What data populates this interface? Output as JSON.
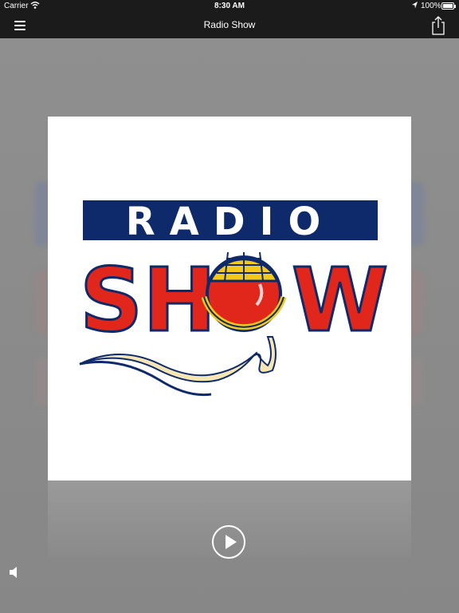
{
  "status_bar": {
    "carrier": "Carrier",
    "time": "8:30 AM",
    "battery": "100%"
  },
  "nav_bar": {
    "title": "Radio Show",
    "menu_icon": "hamburger-menu-icon",
    "share_icon": "share-icon"
  },
  "artwork": {
    "logo_top": "RADIO",
    "logo_bottom_left": "SH",
    "logo_bottom_right": "W",
    "colors": {
      "navy": "#0f2a6b",
      "red": "#e1261c",
      "yellow": "#f2c81a",
      "cream": "#f6e6b4"
    }
  },
  "player": {
    "play_icon": "play-icon",
    "volume_icon": "speaker-icon"
  }
}
